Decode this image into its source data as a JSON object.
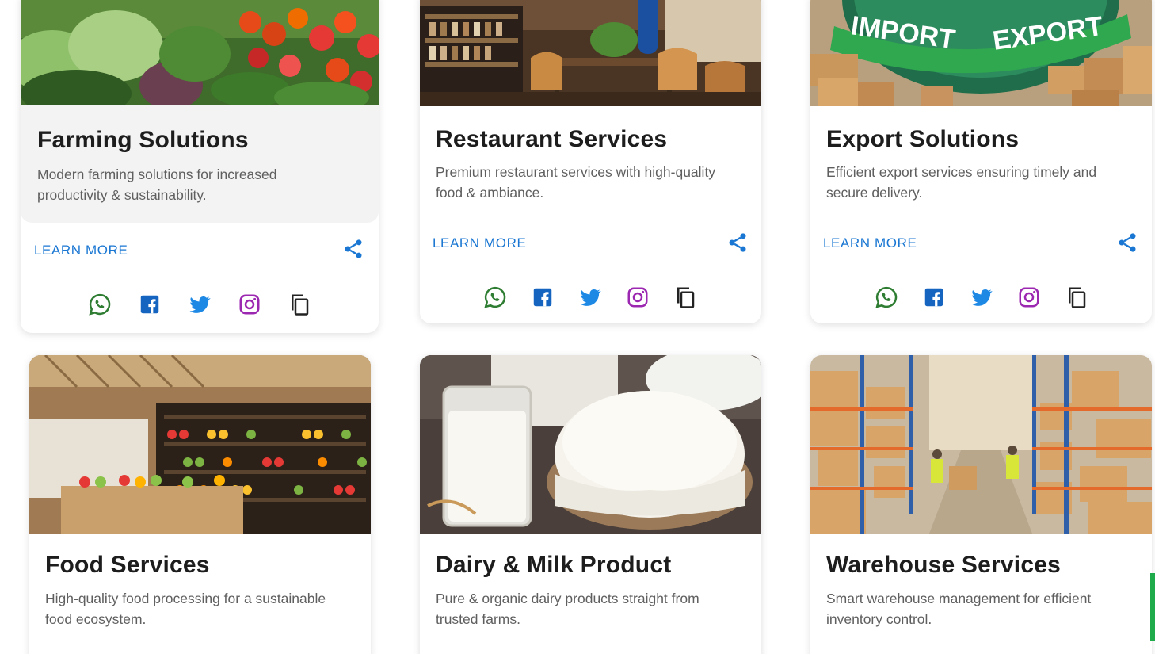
{
  "cards": [
    {
      "title": "Farming Solutions",
      "description": "Modern farming solutions for increased productivity & sustainability.",
      "learn_more": "LEARN MORE",
      "image": "vegetable-field-photo"
    },
    {
      "title": "Restaurant Services",
      "description": "Premium restaurant services with high-quality food & ambiance.",
      "learn_more": "LEARN MORE",
      "image": "restaurant-interior-photo"
    },
    {
      "title": "Export Solutions",
      "description": "Efficient export services ensuring timely and secure delivery.",
      "learn_more": "LEARN MORE",
      "image": "import-export-globe-photo",
      "image_text": [
        "IMPORT",
        "EXPORT"
      ]
    },
    {
      "title": "Food Services",
      "description": "High-quality food processing for a sustainable food ecosystem.",
      "image": "grocery-store-photo"
    },
    {
      "title": "Dairy & Milk Product",
      "description": "Pure & organic dairy products straight from trusted farms.",
      "image": "milk-and-cheese-photo"
    },
    {
      "title": "Warehouse Services",
      "description": "Smart warehouse management for efficient inventory control.",
      "image": "warehouse-photo"
    }
  ],
  "share_icons": [
    "whatsapp-icon",
    "facebook-icon",
    "twitter-icon",
    "instagram-icon",
    "copy-icon"
  ],
  "colors": {
    "link": "#1976d2",
    "whatsapp": "#2e7d32",
    "facebook": "#1565c0",
    "twitter": "#1e88e5",
    "instagram": "#9c27b0",
    "copy": "#222222"
  }
}
